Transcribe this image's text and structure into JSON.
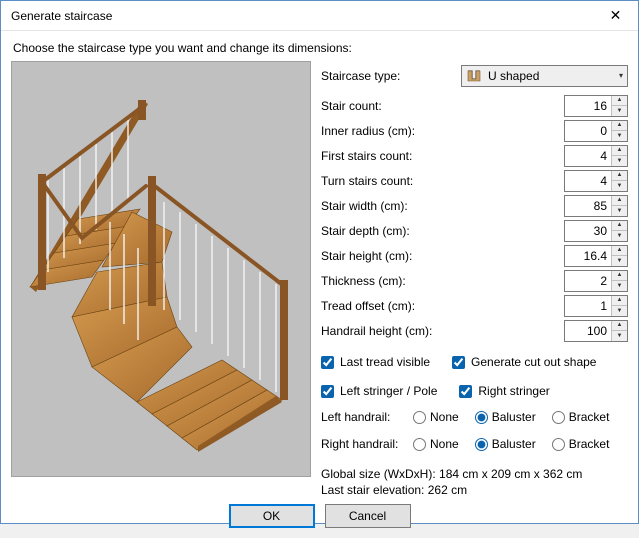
{
  "window": {
    "title": "Generate staircase",
    "close_label": "✕"
  },
  "prompt": "Choose the staircase type you want and change its dimensions:",
  "type_field": {
    "label": "Staircase type:",
    "value": "U shaped"
  },
  "fields": [
    {
      "label": "Stair count:",
      "value": "16"
    },
    {
      "label": "Inner radius (cm):",
      "value": "0"
    },
    {
      "label": "First stairs count:",
      "value": "4"
    },
    {
      "label": "Turn stairs count:",
      "value": "4"
    },
    {
      "label": "Stair width (cm):",
      "value": "85"
    },
    {
      "label": "Stair depth (cm):",
      "value": "30"
    },
    {
      "label": "Stair height (cm):",
      "value": "16.4"
    },
    {
      "label": "Thickness (cm):",
      "value": "2"
    },
    {
      "label": "Tread offset (cm):",
      "value": "1"
    },
    {
      "label": "Handrail height (cm):",
      "value": "100"
    }
  ],
  "checks": {
    "last_tread": {
      "label": "Last tread visible",
      "checked": true
    },
    "cut_out": {
      "label": "Generate cut out shape",
      "checked": true
    },
    "left_stringer": {
      "label": "Left stringer / Pole",
      "checked": true
    },
    "right_stringer": {
      "label": "Right stringer",
      "checked": true
    }
  },
  "handrails": {
    "left": {
      "label": "Left handrail:",
      "options": [
        "None",
        "Baluster",
        "Bracket"
      ],
      "selected": "Baluster"
    },
    "right": {
      "label": "Right handrail:",
      "options": [
        "None",
        "Baluster",
        "Bracket"
      ],
      "selected": "Baluster"
    }
  },
  "status": {
    "line1": "Global size (WxDxH): 184 cm x 209 cm x 362 cm",
    "line2": "Last stair elevation: 262 cm"
  },
  "buttons": {
    "ok": "OK",
    "cancel": "Cancel"
  }
}
